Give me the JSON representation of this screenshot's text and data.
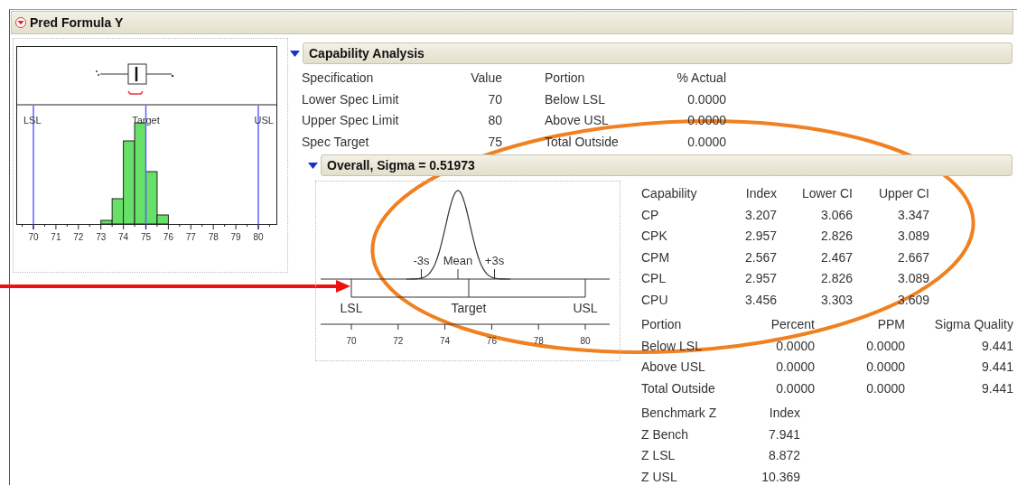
{
  "title": "Pred Formula Y",
  "distribution_plot": {
    "spec_labels": [
      "LSL",
      "Target",
      "USL"
    ],
    "x_tick_labels": [
      "70",
      "71",
      "72",
      "73",
      "74",
      "75",
      "76",
      "77",
      "78",
      "79",
      "80"
    ]
  },
  "capability_analysis": {
    "title": "Capability Analysis",
    "expanded": true,
    "spec_table": {
      "columns": [
        "Specification",
        "Value",
        "Portion",
        "% Actual"
      ],
      "rows": [
        [
          "Lower Spec Limit",
          "70",
          "Below LSL",
          "0.0000"
        ],
        [
          "Upper Spec Limit",
          "80",
          "Above USL",
          "0.0000"
        ],
        [
          "Spec Target",
          "75",
          "Total Outside",
          "0.0000"
        ]
      ]
    },
    "overall": {
      "title": "Overall,  Sigma = 0.51973",
      "expanded": true,
      "plot": {
        "sigma_labels": [
          "-3s",
          "Mean",
          "+3s"
        ],
        "spec_labels": [
          "LSL",
          "Target",
          "USL"
        ],
        "x_tick_labels": [
          "70",
          "72",
          "74",
          "76",
          "78",
          "80"
        ]
      },
      "capability_table": {
        "columns": [
          "Capability",
          "Index",
          "Lower CI",
          "Upper CI"
        ],
        "rows": [
          [
            "CP",
            "3.207",
            "3.066",
            "3.347"
          ],
          [
            "CPK",
            "2.957",
            "2.826",
            "3.089"
          ],
          [
            "CPM",
            "2.567",
            "2.467",
            "2.667"
          ],
          [
            "CPL",
            "2.957",
            "2.826",
            "3.089"
          ],
          [
            "CPU",
            "3.456",
            "3.303",
            "3.609"
          ]
        ]
      },
      "portion_table": {
        "columns": [
          "Portion",
          "Percent",
          "PPM",
          "Sigma Quality"
        ],
        "rows": [
          [
            "Below LSL",
            "0.0000",
            "0.0000",
            "9.441"
          ],
          [
            "Above USL",
            "0.0000",
            "0.0000",
            "9.441"
          ],
          [
            "Total Outside",
            "0.0000",
            "0.0000",
            "9.441"
          ]
        ]
      },
      "benchmark_table": {
        "columns": [
          "Benchmark Z",
          "Index"
        ],
        "rows": [
          [
            "Z Bench",
            "7.941"
          ],
          [
            "Z LSL",
            "8.872"
          ],
          [
            "Z USL",
            "10.369"
          ]
        ]
      }
    }
  }
}
